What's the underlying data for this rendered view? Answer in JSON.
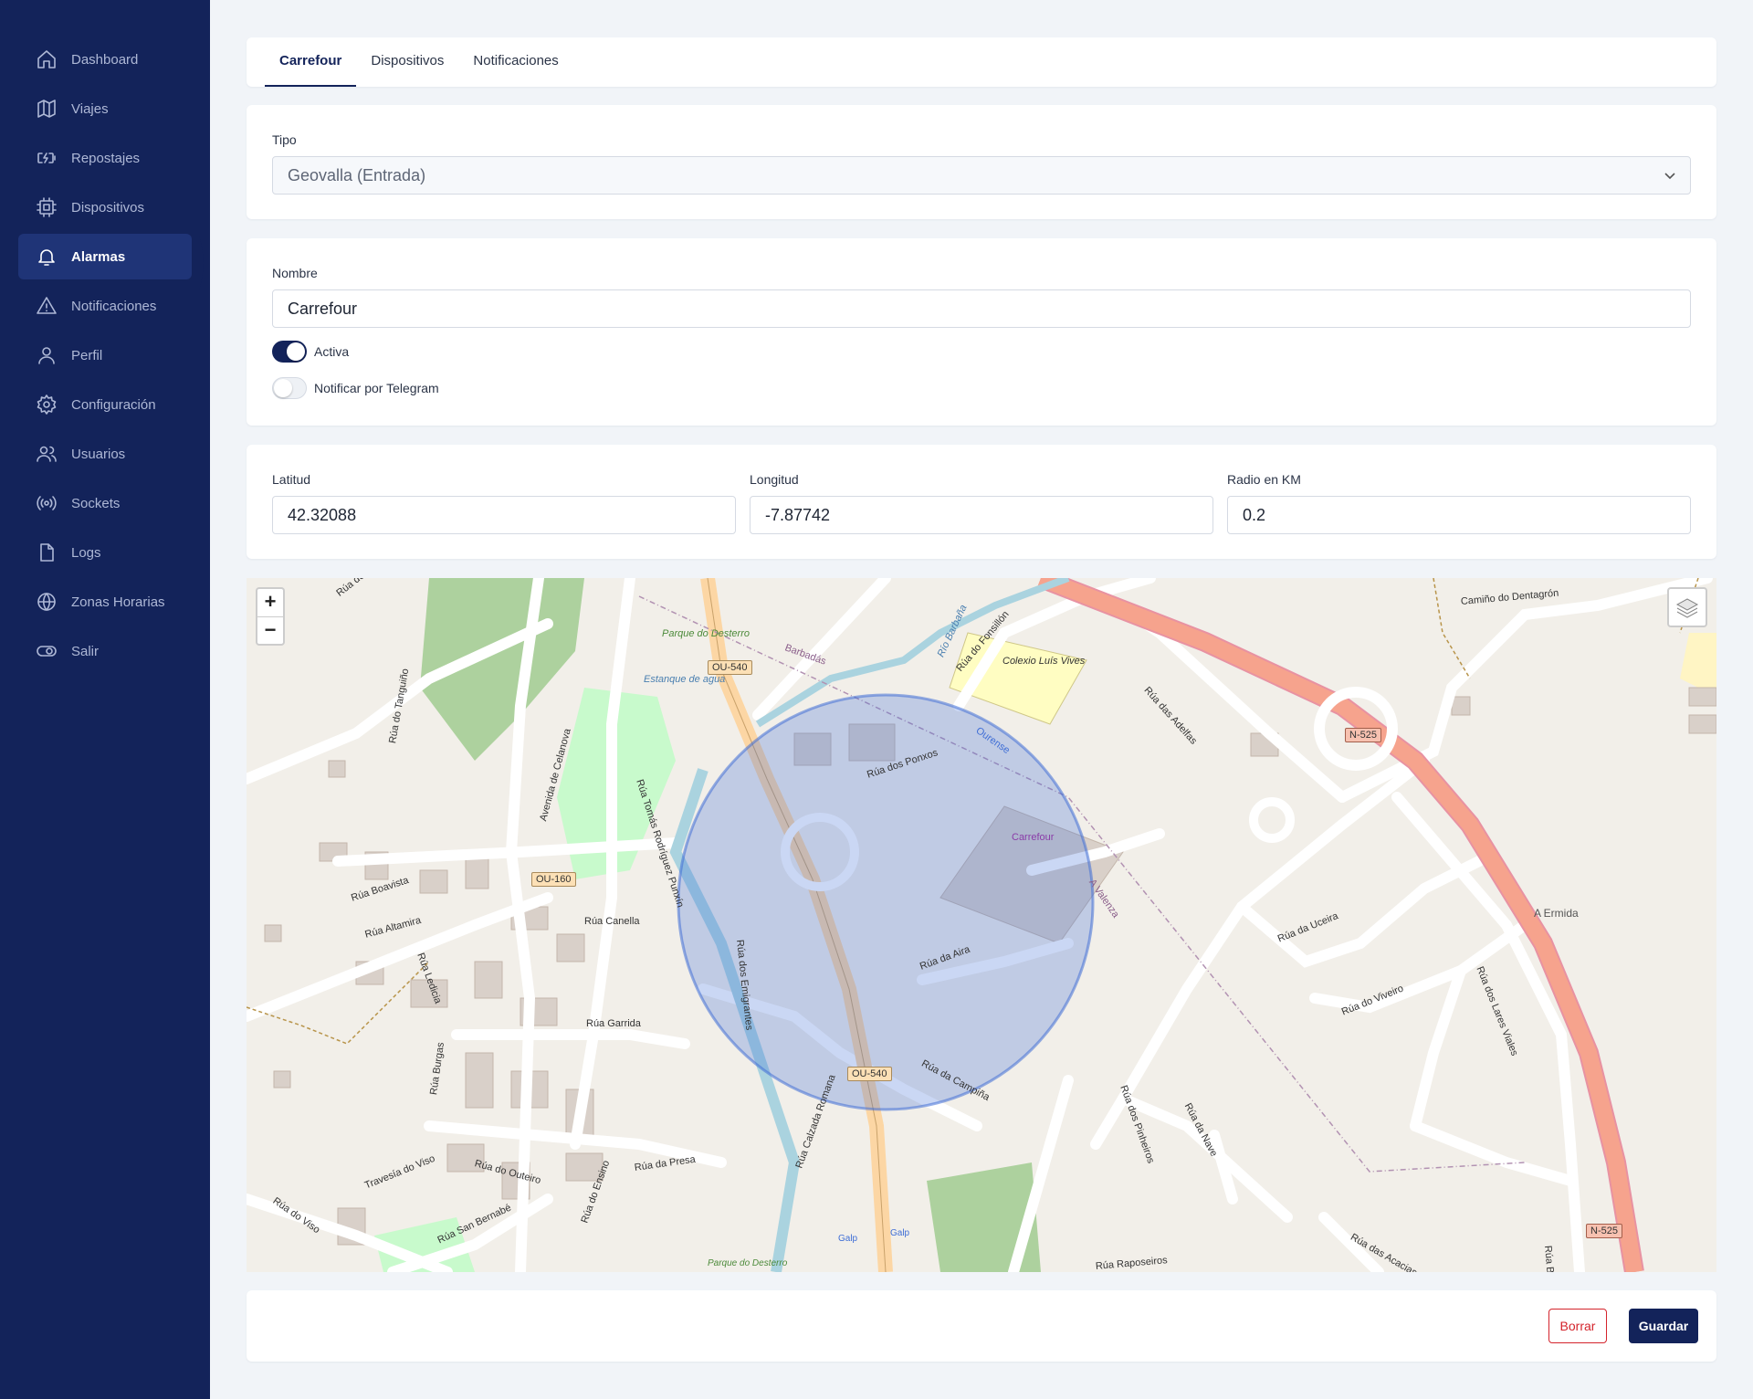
{
  "sidebar": {
    "items": [
      {
        "label": "Dashboard",
        "icon": "home-icon",
        "active": false
      },
      {
        "label": "Viajes",
        "icon": "map-icon",
        "active": false
      },
      {
        "label": "Repostajes",
        "icon": "battery-charge-icon",
        "active": false
      },
      {
        "label": "Dispositivos",
        "icon": "chip-icon",
        "active": false
      },
      {
        "label": "Alarmas",
        "icon": "bell-icon",
        "active": true
      },
      {
        "label": "Notificaciones",
        "icon": "warning-icon",
        "active": false
      },
      {
        "label": "Perfil",
        "icon": "user-icon",
        "active": false
      },
      {
        "label": "Configuración",
        "icon": "gear-icon",
        "active": false
      },
      {
        "label": "Usuarios",
        "icon": "users-icon",
        "active": false
      },
      {
        "label": "Sockets",
        "icon": "broadcast-icon",
        "active": false
      },
      {
        "label": "Logs",
        "icon": "file-icon",
        "active": false
      },
      {
        "label": "Zonas Horarias",
        "icon": "globe-icon",
        "active": false
      },
      {
        "label": "Salir",
        "icon": "toggle-exit-icon",
        "active": false
      }
    ]
  },
  "tabs": [
    {
      "label": "Carrefour",
      "active": true
    },
    {
      "label": "Dispositivos",
      "active": false
    },
    {
      "label": "Notificaciones",
      "active": false
    }
  ],
  "tipo": {
    "label": "Tipo",
    "value": "Geovalla (Entrada)"
  },
  "nombre": {
    "label": "Nombre",
    "value": "Carrefour"
  },
  "toggles": {
    "activa": {
      "label": "Activa",
      "on": true
    },
    "telegram": {
      "label": "Notificar por Telegram",
      "on": false
    }
  },
  "coords": {
    "lat": {
      "label": "Latitud",
      "value": "42.32088"
    },
    "lon": {
      "label": "Longitud",
      "value": "-7.87742"
    },
    "radius": {
      "label": "Radio en KM",
      "value": "0.2"
    }
  },
  "map": {
    "zoom_in": "+",
    "zoom_out": "−",
    "labels": [
      "Rúa do Millad",
      "Rúa do Tanguiño",
      "Avenida de Celanova",
      "Rúa Tomás Rodríguez Punxín",
      "Parque do Desterro",
      "Estanque de agua",
      "Barbadás",
      "Río Barbaña",
      "Rúa do Fonsillón",
      "Colexio Luís Vives",
      "Rúa dos Ponxos",
      "Carrefour",
      "Ourense",
      "A Valenza",
      "Rúa das Adelfas",
      "Camiño do Dentagrón",
      "A Ermida",
      "Rúa dos Lares Viales",
      "Rúa da Uceira",
      "Rúa do Viveiro",
      "Rúa Boavista",
      "Rúa Altamira",
      "Rúa Canella",
      "Rúa Garrida",
      "Rúa Burgas",
      "Rúa Ledicia",
      "Rúa dos Emigrantes",
      "Rúa da Aira",
      "Rúa da Campiña",
      "Rúa Calzada Romana",
      "Rúa da Presa",
      "Rúa do Outeiro",
      "Travesía do Viso",
      "Rúa do Viso",
      "Rúa San Bernabé",
      "Rúa do Ensino",
      "Rúa dos Pinheiros",
      "Rúa da Nave",
      "Rúa das Acacias",
      "Rúa Burata",
      "Rúa Raposeiros",
      "Galp",
      "Galp",
      "Parque do Desterro"
    ],
    "shields": [
      "OU-540",
      "OU-160",
      "OU-540",
      "N-525",
      "N-525"
    ]
  },
  "actions": {
    "delete": "Borrar",
    "save": "Guardar"
  }
}
